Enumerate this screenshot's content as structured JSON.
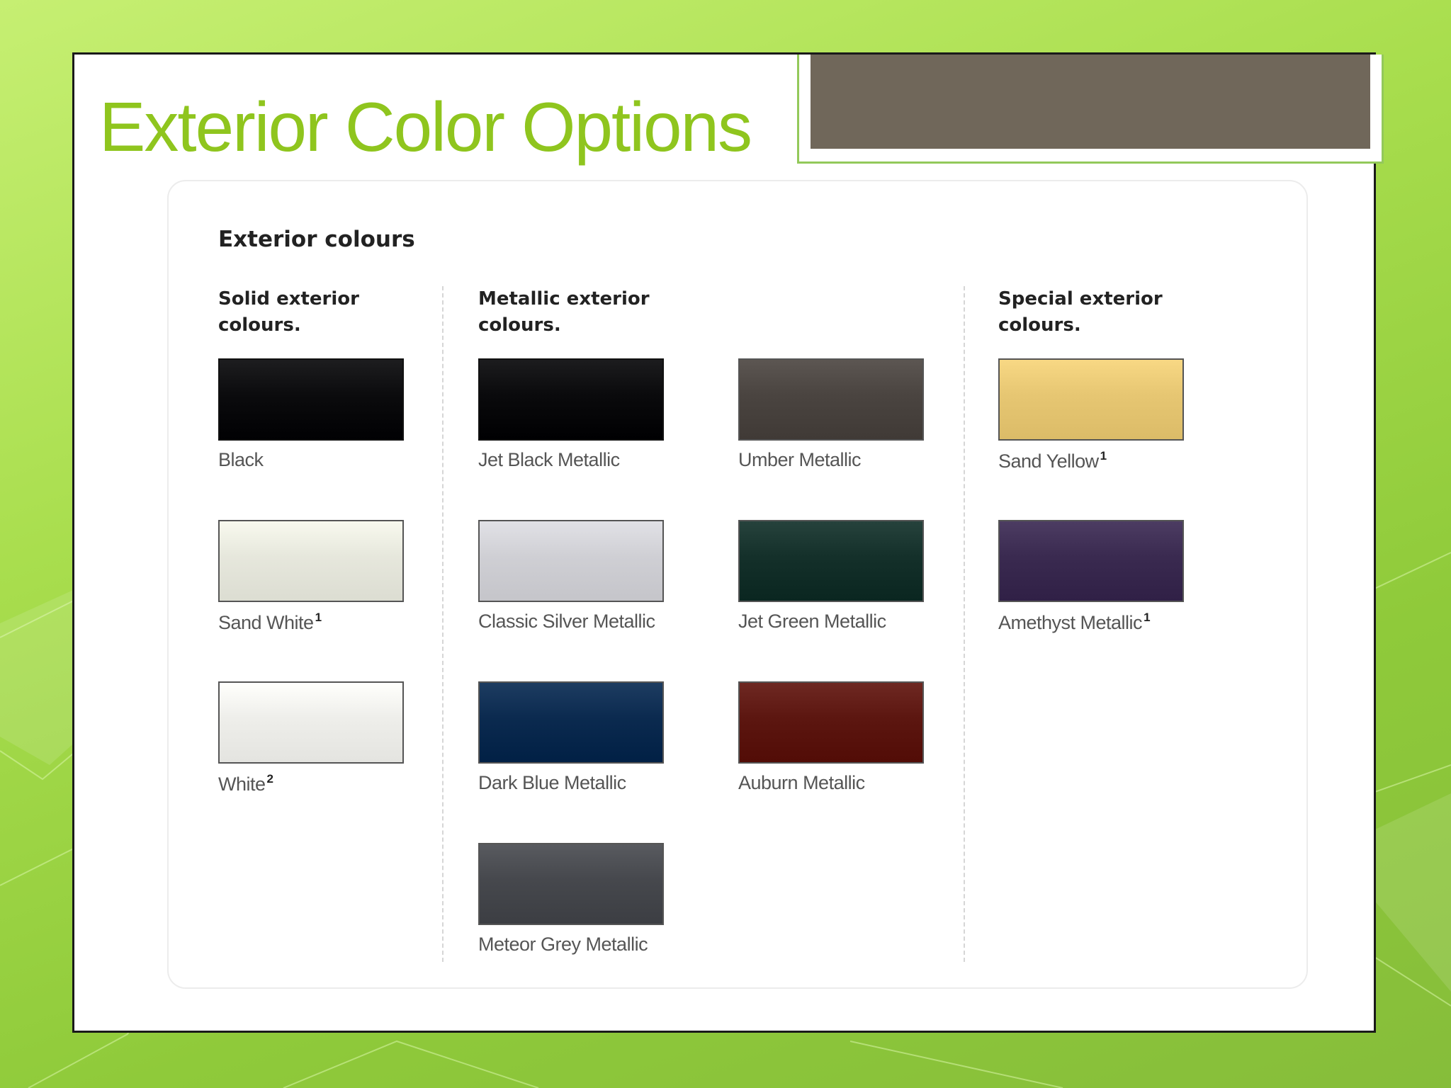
{
  "slide": {
    "title": "Exterior Color Options"
  },
  "panel": {
    "heading": "Exterior colours",
    "groups": [
      {
        "heading": "Solid exterior colours."
      },
      {
        "heading": "Metallic exterior colours."
      },
      {
        "heading": "Special exterior colours."
      }
    ],
    "swatches": [
      {
        "name": "Black",
        "note": "",
        "color": "#0b0b0d"
      },
      {
        "name": "Sand White",
        "note": "1",
        "color": "#e6e7dc"
      },
      {
        "name": "White",
        "note": "2",
        "color": "#eeeeea"
      },
      {
        "name": "Jet Black Metallic",
        "note": "",
        "color": "#0a0a0c"
      },
      {
        "name": "Classic Silver Metallic",
        "note": "",
        "color": "#cfcfd4"
      },
      {
        "name": "Dark Blue Metallic",
        "note": "",
        "color": "#0b2a4f"
      },
      {
        "name": "Meteor Grey Metallic",
        "note": "",
        "color": "#46484d"
      },
      {
        "name": "Umber Metallic",
        "note": "",
        "color": "#4a4440"
      },
      {
        "name": "Jet Green Metallic",
        "note": "",
        "color": "#14302a"
      },
      {
        "name": "Auburn Metallic",
        "note": "",
        "color": "#5c1610"
      },
      {
        "name": "Sand Yellow",
        "note": "1",
        "color": "#e6c672"
      },
      {
        "name": "Amethyst Metallic",
        "note": "1",
        "color": "#3a2a50"
      }
    ]
  },
  "colors": {
    "title": "#8fc51e",
    "title_box": "#70675a",
    "background": "#a9de4e"
  }
}
